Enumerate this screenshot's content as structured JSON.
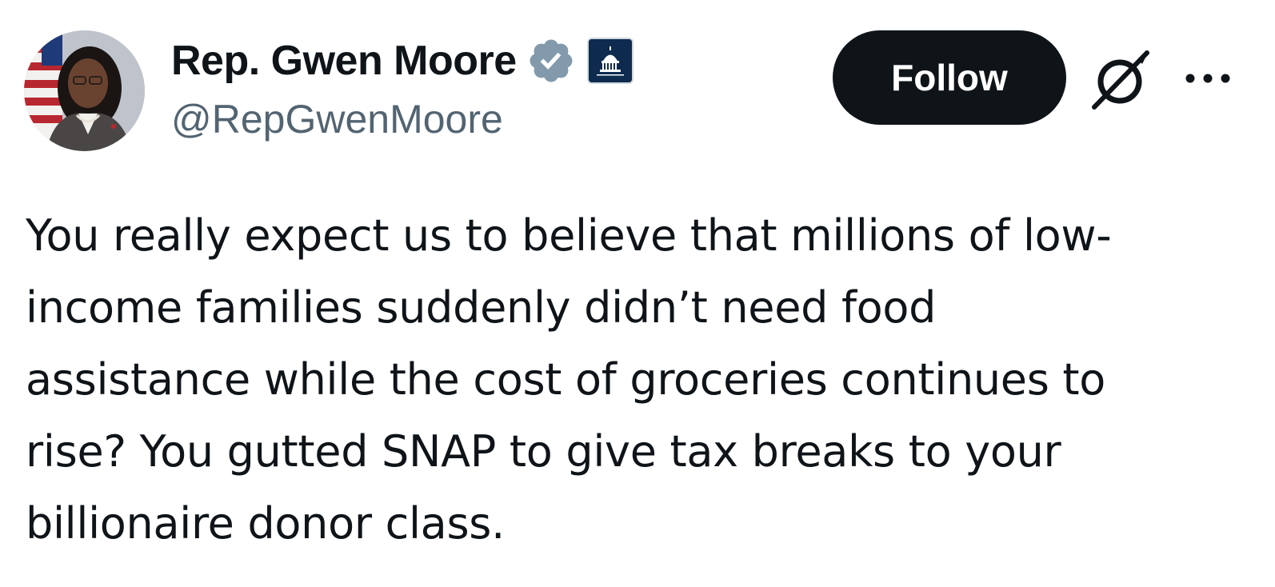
{
  "author": {
    "display_name": "Rep. Gwen Moore",
    "handle": "@RepGwenMoore",
    "verified": true,
    "verified_color": "#829aab",
    "affiliate_badge": "house-democrats-capitol-badge"
  },
  "actions": {
    "follow_label": "Follow",
    "grok_icon": "grok-icon",
    "more_icon": "more-options-icon"
  },
  "tweet": {
    "lines": [
      "You really expect us to believe that millions of low-",
      "income families suddenly didn’t need food",
      "assistance while the cost of groceries continues to",
      "rise? You gutted SNAP to give tax breaks to your",
      "billionaire donor class."
    ]
  },
  "colors": {
    "text": "#0f1419",
    "secondary_text": "#536471",
    "button_bg": "#0f1419",
    "button_text": "#ffffff"
  }
}
